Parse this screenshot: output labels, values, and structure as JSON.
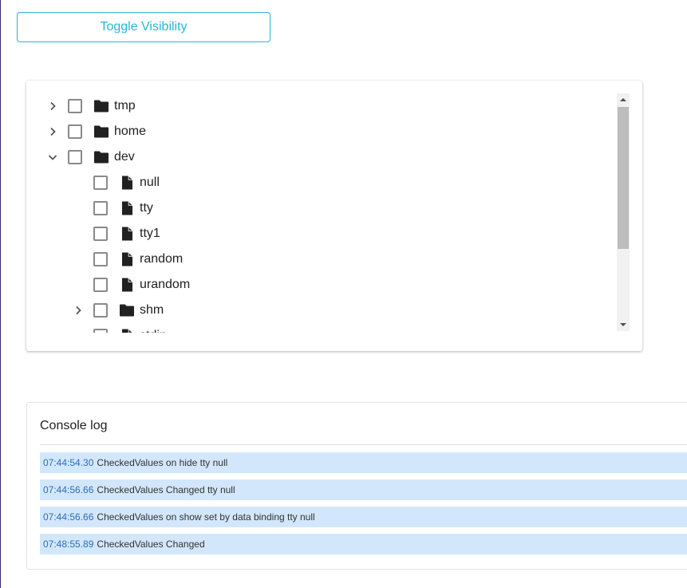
{
  "toolbar": {
    "toggle_label": "Toggle Visibility"
  },
  "tree": {
    "nodes": [
      {
        "label": "tmp",
        "type": "folder",
        "expander": "collapsed",
        "level": 0
      },
      {
        "label": "home",
        "type": "folder",
        "expander": "collapsed",
        "level": 0
      },
      {
        "label": "dev",
        "type": "folder",
        "expander": "expanded",
        "level": 0
      },
      {
        "label": "null",
        "type": "file",
        "expander": "none",
        "level": 1
      },
      {
        "label": "tty",
        "type": "file",
        "expander": "none",
        "level": 1
      },
      {
        "label": "tty1",
        "type": "file",
        "expander": "none",
        "level": 1
      },
      {
        "label": "random",
        "type": "file",
        "expander": "none",
        "level": 1
      },
      {
        "label": "urandom",
        "type": "file",
        "expander": "none",
        "level": 1
      },
      {
        "label": "shm",
        "type": "folder",
        "expander": "collapsed",
        "level": 1
      },
      {
        "label": "stdin",
        "type": "file",
        "expander": "none",
        "level": 1
      }
    ]
  },
  "console": {
    "title": "Console log",
    "entries": [
      {
        "time": "07:44:54.30",
        "message": "CheckedValues on hide tty null"
      },
      {
        "time": "07:44:56.66",
        "message": "CheckedValues Changed tty null"
      },
      {
        "time": "07:44:56.66",
        "message": "CheckedValues on show set by data binding tty null"
      },
      {
        "time": "07:48:55.89",
        "message": "CheckedValues Changed"
      }
    ]
  },
  "colors": {
    "accent": "#29b6d8",
    "log_bg": "#d2e7fb",
    "log_time": "#2a6ebb"
  },
  "icons": {
    "folder": "folder-icon",
    "file": "file-icon",
    "collapsed": "chevron-right-icon",
    "expanded": "chevron-down-icon"
  }
}
